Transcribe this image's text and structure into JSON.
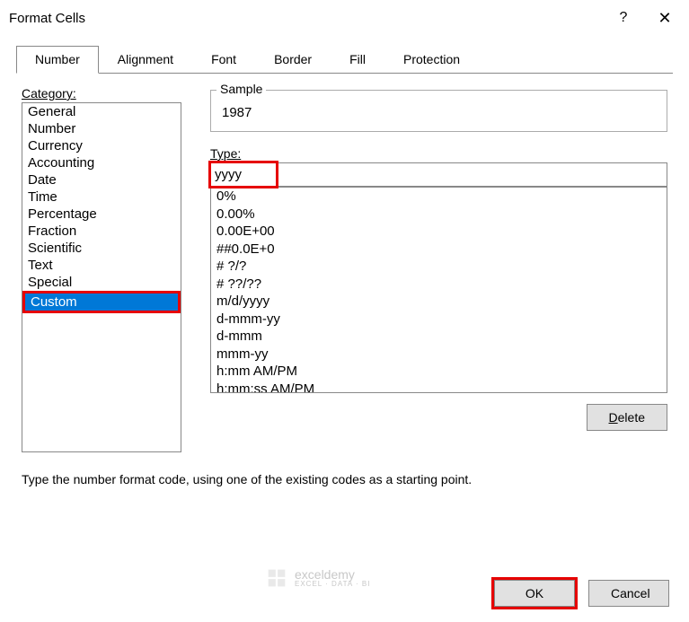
{
  "titlebar": {
    "title": "Format Cells",
    "help": "?",
    "close": "✕"
  },
  "tabs": {
    "items": [
      {
        "label": "Number",
        "active": true
      },
      {
        "label": "Alignment",
        "active": false
      },
      {
        "label": "Font",
        "active": false
      },
      {
        "label": "Border",
        "active": false
      },
      {
        "label": "Fill",
        "active": false
      },
      {
        "label": "Protection",
        "active": false
      }
    ]
  },
  "category": {
    "label": "Category:",
    "items": [
      "General",
      "Number",
      "Currency",
      "Accounting",
      "Date",
      "Time",
      "Percentage",
      "Fraction",
      "Scientific",
      "Text",
      "Special",
      "Custom"
    ],
    "selected": "Custom"
  },
  "sample": {
    "label": "Sample",
    "value": "1987"
  },
  "type": {
    "label": "Type:",
    "value": "yyyy",
    "formats": [
      "0%",
      "0.00%",
      "0.00E+00",
      "##0.0E+0",
      "# ?/?",
      "# ??/??",
      "m/d/yyyy",
      "d-mmm-yy",
      "d-mmm",
      "mmm-yy",
      "h:mm AM/PM",
      "h:mm:ss AM/PM"
    ]
  },
  "buttons": {
    "delete": "Delete",
    "ok": "OK",
    "cancel": "Cancel"
  },
  "hint": "Type the number format code, using one of the existing codes as a starting point.",
  "watermark": {
    "text": "exceldemy",
    "sub": "EXCEL · DATA · BI"
  }
}
